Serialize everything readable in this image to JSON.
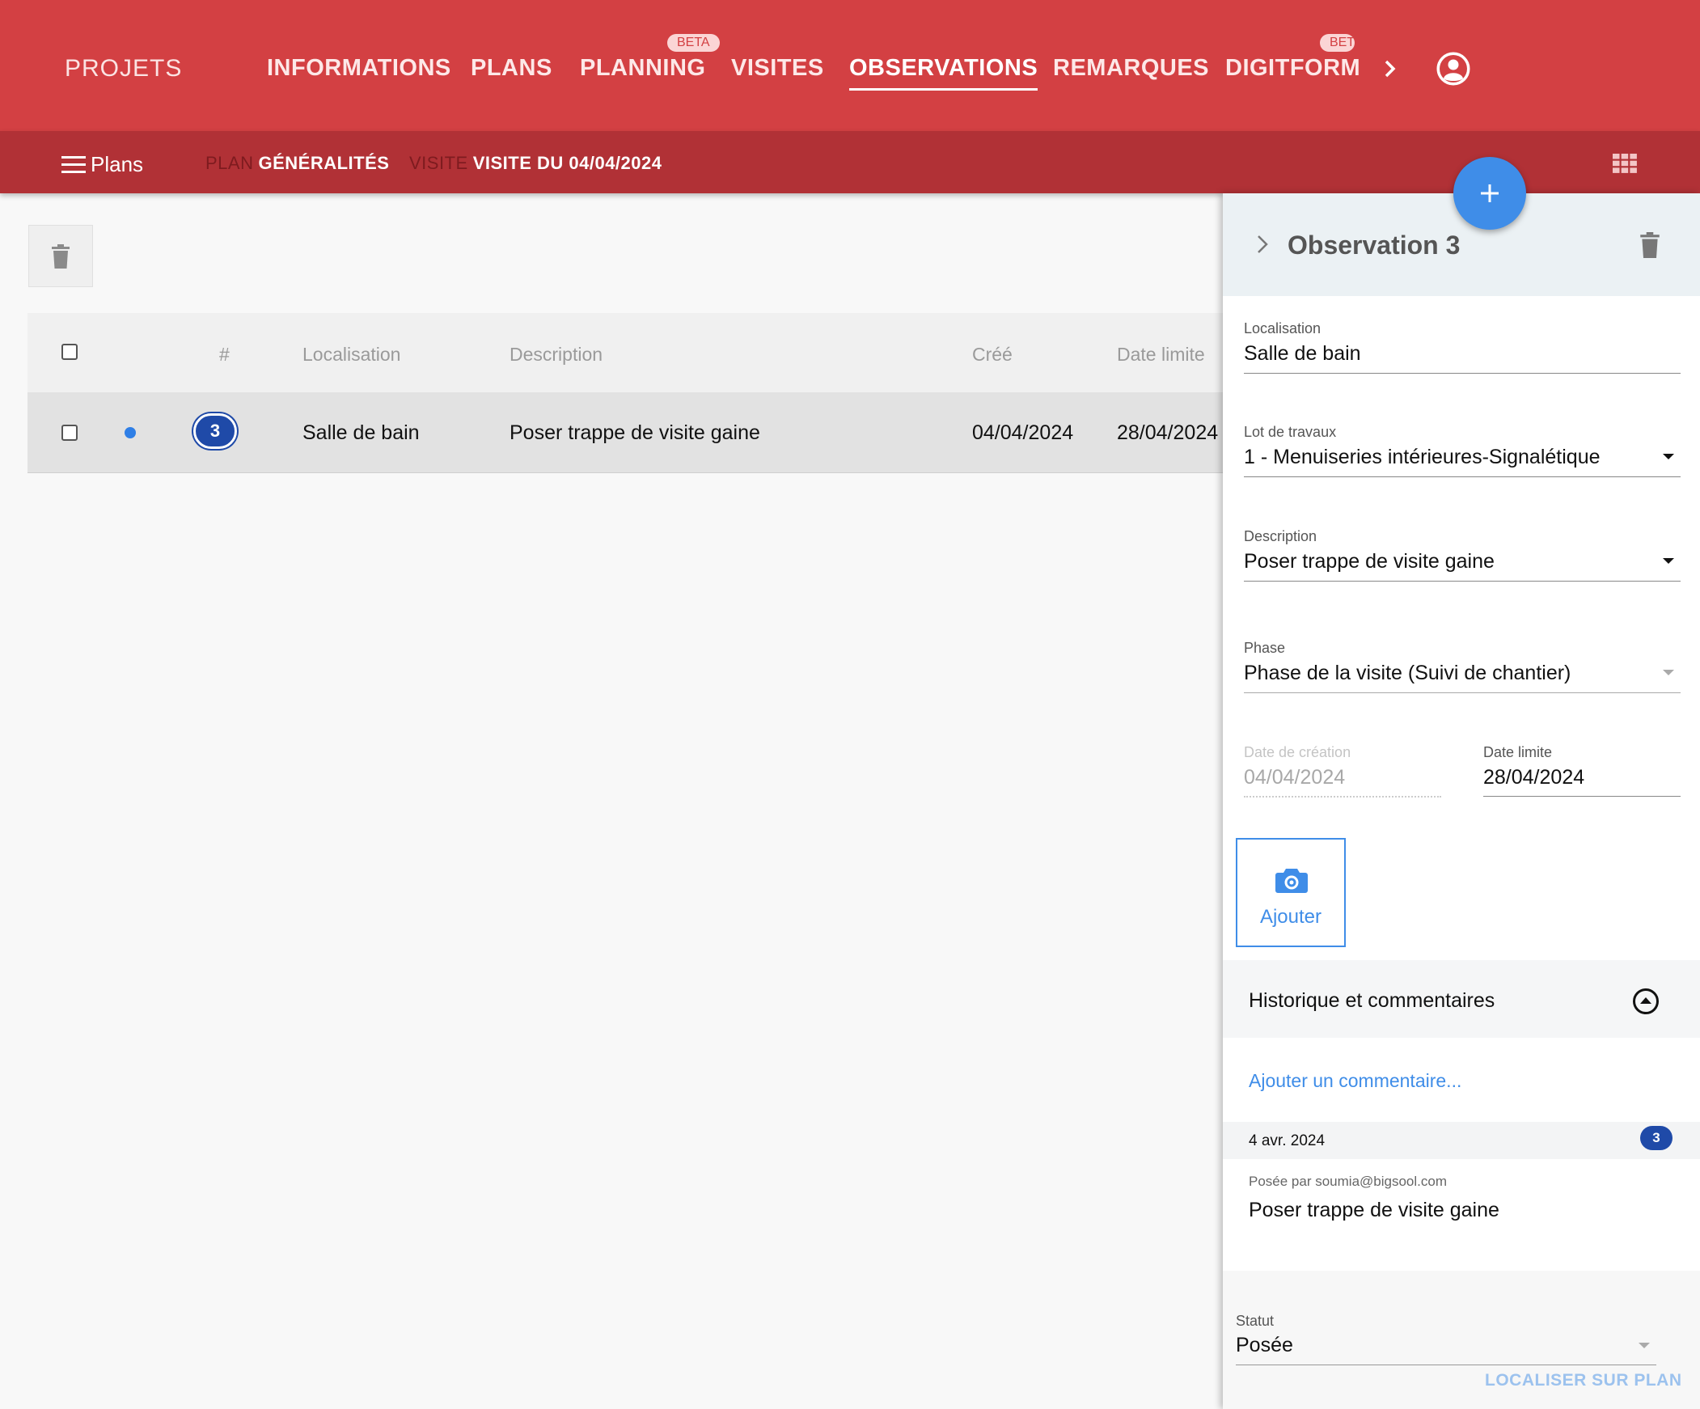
{
  "header": {
    "brand": "PROJETS",
    "nav": [
      {
        "label": "INFORMATIONS",
        "active": false
      },
      {
        "label": "PLANS",
        "active": false
      },
      {
        "label": "PLANNING",
        "active": false,
        "badge": "BETA"
      },
      {
        "label": "VISITES",
        "active": false
      },
      {
        "label": "OBSERVATIONS",
        "active": true
      },
      {
        "label": "REMARQUES",
        "active": false
      },
      {
        "label": "DIGITFORM",
        "active": false,
        "badge": "BET"
      }
    ],
    "more_icon": "chevron-right-icon",
    "account_icon": "user-circle-icon"
  },
  "subbar": {
    "menu_label": "Plans",
    "plan_key": "PLAN",
    "plan_value": "GÉNÉRALITÉS",
    "visit_key": "VISITE",
    "visit_value": "VISITE DU 04/04/2024",
    "view_icon": "grid-view-icon"
  },
  "table": {
    "columns": {
      "number": "#",
      "location": "Localisation",
      "description": "Description",
      "created": "Créé",
      "deadline": "Date limite"
    },
    "rows": [
      {
        "number": "3",
        "location": "Salle de bain",
        "description": "Poser trappe de visite gaine",
        "created": "04/04/2024",
        "deadline": "28/04/2024",
        "checked": false
      }
    ]
  },
  "panel": {
    "title": "Observation 3",
    "fields": {
      "location": {
        "label": "Localisation",
        "value": "Salle de bain"
      },
      "lot": {
        "label": "Lot de travaux",
        "value": "1 - Menuiseries intérieures-Signalétique"
      },
      "description": {
        "label": "Description",
        "value": "Poser trappe de visite gaine"
      },
      "phase": {
        "label": "Phase",
        "value": "Phase de la visite (Suivi de chantier)"
      },
      "created": {
        "label": "Date de création",
        "value": "04/04/2024"
      },
      "deadline": {
        "label": "Date limite",
        "value": "28/04/2024"
      }
    },
    "photo_button": "Ajouter",
    "history": {
      "title": "Historique et commentaires",
      "add_comment": "Ajouter un commentaire...",
      "entry_date": "4 avr. 2024",
      "entry_badge": "3",
      "entry_by": "Posée par soumia@bigsool.com",
      "entry_text": "Poser trappe de visite gaine"
    },
    "status": {
      "label": "Statut",
      "value": "Posée"
    },
    "localize_button": "LOCALISER SUR PLAN"
  },
  "colors": {
    "primary": "#d34043",
    "primary_dark": "#b13136",
    "accent": "#3f8de8",
    "badge": "#1f4aa8"
  }
}
